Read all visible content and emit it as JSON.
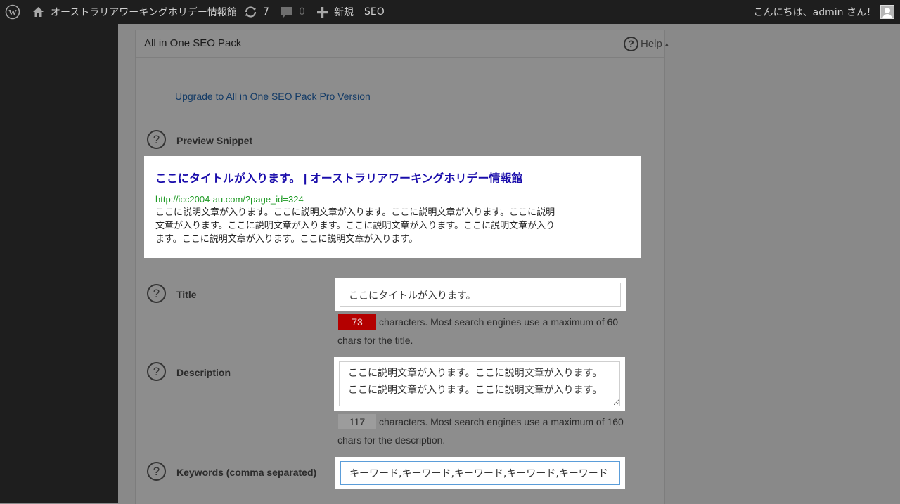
{
  "adminbar": {
    "site_name": "オーストラリアワーキングホリデー情報館",
    "updates_count": "7",
    "comments_count": "0",
    "new_label": "新規",
    "seo_label": "SEO",
    "greeting": "こんにちは、admin さん！"
  },
  "panel": {
    "title": "All in One SEO Pack",
    "help_label": "Help",
    "upgrade_link": "Upgrade to All in One SEO Pack Pro Version"
  },
  "snippet": {
    "label": "Preview Snippet",
    "title": "ここにタイトルが入ります。 | オーストラリアワーキングホリデー情報館",
    "url": "http://icc2004-au.com/?page_id=324",
    "description": "ここに説明文章が入ります。ここに説明文章が入ります。ここに説明文章が入ります。ここに説明文章が入ります。ここに説明文章が入ります。ここに説明文章が入ります。ここに説明文章が入ります。ここに説明文章が入ります。ここに説明文章が入ります。"
  },
  "title_field": {
    "label": "Title",
    "value": "ここにタイトルが入ります。",
    "count": "73",
    "hint": "characters. Most search engines use a maximum of 60 chars for the title."
  },
  "description_field": {
    "label": "Description",
    "value": "ここに説明文章が入ります。ここに説明文章が入ります。ここに説明文章が入ります。ここに説明文章が入ります。",
    "count": "117",
    "hint": "characters. Most search engines use a maximum of 160 chars for the description."
  },
  "keywords_field": {
    "label": "Keywords (comma separated)",
    "value": "キーワード,キーワード,キーワード,キーワード,キーワード"
  },
  "colors": {
    "adminbar_bg": "#1e1e1e",
    "overlay_bg": "#8a8a8a",
    "link_blue": "#1a0dab",
    "url_green": "#1e9a24",
    "over_limit_red": "#b40000"
  },
  "icons": [
    "wordpress-icon",
    "home-icon",
    "updates-icon",
    "comments-icon",
    "plus-icon",
    "help-icon",
    "avatar-icon"
  ]
}
